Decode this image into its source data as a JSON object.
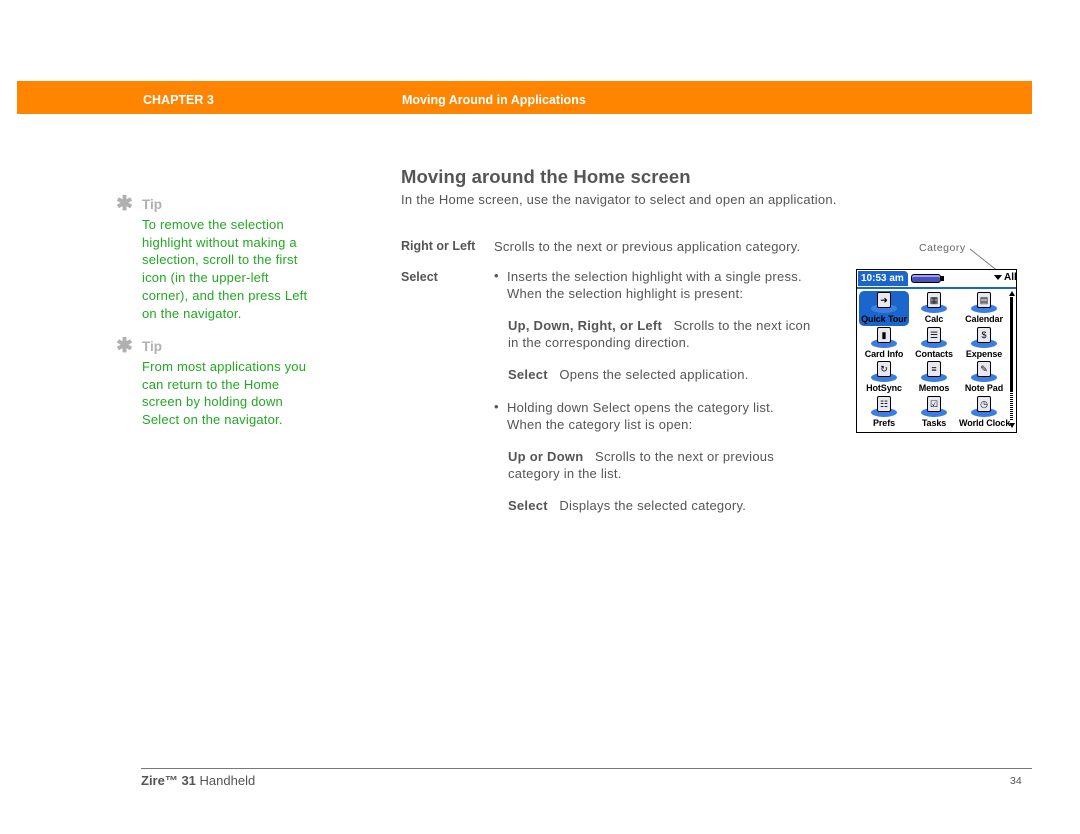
{
  "header": {
    "chapter": "CHAPTER 3",
    "title": "Moving Around in Applications",
    "color": "#ff8400"
  },
  "tips": [
    {
      "icon": "asterisk-icon",
      "label": "Tip",
      "text": "To remove the selection highlight without making a selection, scroll to the first icon (in the upper-left corner), and then press Left on the navigator."
    },
    {
      "icon": "asterisk-icon",
      "label": "Tip",
      "text": "From most applications you can return to the Home screen by holding down Select on the navigator."
    }
  ],
  "section": {
    "title": "Moving around the Home screen",
    "intro": "In the Home screen, use the navigator to select and open an application.",
    "entries": {
      "right_left": {
        "term": "Right or Left",
        "desc": "Scrolls to the next or previous application category."
      },
      "select": {
        "term": "Select",
        "bullet1_line1": "Inserts the selection highlight with a single press.",
        "bullet1_line2": "When the selection highlight is present:",
        "sub1_term": "Up, Down, Right, or Left",
        "sub1_desc_line1": "Scrolls to the next icon",
        "sub1_desc_line2": "in the corresponding direction.",
        "sub2_term": "Select",
        "sub2_desc": "Opens the selected application.",
        "bullet2_line1": "Holding down Select opens the category list.",
        "bullet2_line2": "When the category list is open:",
        "sub3_term": "Up or Down",
        "sub3_desc_line1": "Scrolls to the next or previous",
        "sub3_desc_line2": "category in the list.",
        "sub4_term": "Select",
        "sub4_desc": "Displays the selected category."
      },
      "bullet_char": "•"
    }
  },
  "screenshot": {
    "callout": "Category",
    "time": "10:53 am",
    "category": "All",
    "accent": "#1a66cc",
    "apps": [
      {
        "label": "Quick Tour",
        "glyph": "➜",
        "selected": true
      },
      {
        "label": "Calc",
        "glyph": "▦"
      },
      {
        "label": "Calendar",
        "glyph": "▤"
      },
      {
        "label": "Card Info",
        "glyph": "▮"
      },
      {
        "label": "Contacts",
        "glyph": "☰"
      },
      {
        "label": "Expense",
        "glyph": "$"
      },
      {
        "label": "HotSync",
        "glyph": "↻"
      },
      {
        "label": "Memos",
        "glyph": "≡"
      },
      {
        "label": "Note Pad",
        "glyph": "✎"
      },
      {
        "label": "Prefs",
        "glyph": "☷"
      },
      {
        "label": "Tasks",
        "glyph": "☑"
      },
      {
        "label": "World Clock",
        "glyph": "◷"
      }
    ]
  },
  "footer": {
    "product_bold": "Zire™ 31",
    "product_rest": " Handheld",
    "page": "34"
  }
}
